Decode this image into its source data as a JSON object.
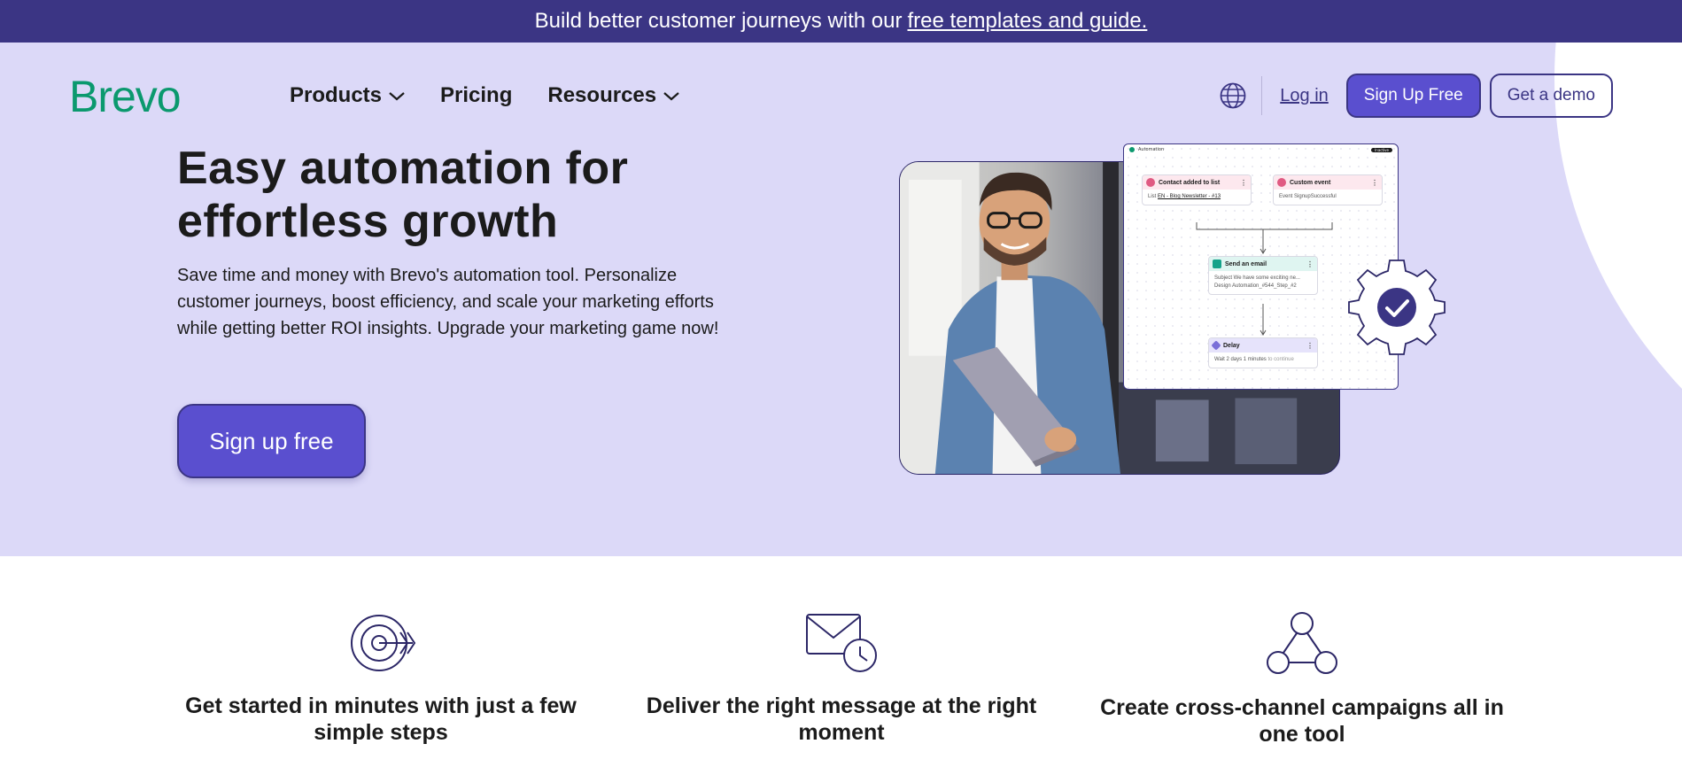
{
  "banner": {
    "text": "Build better customer journeys with our",
    "link": "free templates and guide."
  },
  "header": {
    "logo": "Brevo",
    "nav": [
      {
        "label": "Products",
        "has_dropdown": true
      },
      {
        "label": "Pricing",
        "has_dropdown": false
      },
      {
        "label": "Resources",
        "has_dropdown": true
      }
    ],
    "globe_icon": "globe-icon",
    "login": "Log in",
    "signup": "Sign Up Free",
    "demo": "Get a demo"
  },
  "hero": {
    "title_line1": "Easy automation for",
    "title_line2": "effortless growth",
    "description": "Save time and money with Brevo's automation tool. Personalize customer journeys, boost efficiency, and scale your marketing efforts while getting better ROI insights. Upgrade your marketing game now!",
    "cta": "Sign up free"
  },
  "workflow": {
    "app_title": "Automation",
    "top_button": "Inactive",
    "nodes": [
      {
        "title": "Contact added to list",
        "line_label": "List",
        "line_value": "EN - Blog Newsletter - #13"
      },
      {
        "title": "Custom event",
        "line_label": "Event",
        "line_value": "SignupSuccessful"
      },
      {
        "title": "Send an email",
        "line1": "Subject We have some exciting ne...",
        "line2_label": "Design",
        "line2_value": "Automation_#544_Step_#2"
      },
      {
        "title": "Delay",
        "line_label": "Wait 2 days 1 minutes",
        "line_value": "to continue"
      }
    ]
  },
  "features": [
    {
      "icon": "target-icon",
      "title": "Get started in minutes with just a few simple steps"
    },
    {
      "icon": "email-clock-icon",
      "title": "Deliver the right message at the right moment"
    },
    {
      "icon": "network-icon",
      "title": "Create cross-channel campaigns all in one tool"
    }
  ],
  "colors": {
    "banner_bg": "#3b3584",
    "hero_bg": "#dcd9f8",
    "brand_green": "#0b996e",
    "primary": "#5a4fcf",
    "dark_purple": "#3b3584"
  }
}
